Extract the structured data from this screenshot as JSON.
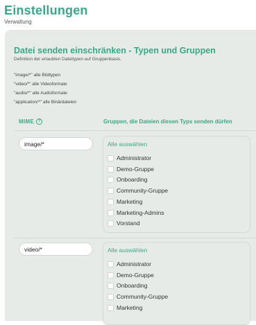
{
  "header": {
    "title": "Einstellungen",
    "subtitle": "Verwaltung"
  },
  "section": {
    "title": "Datei senden einschränken - Typen und Gruppen",
    "subtitle": "Definition der erlaubten Dateitypen auf Gruppenbasis.",
    "hints": [
      "\"image/*\" alle Bildtypen",
      "\"video/*\" alle Videoformate",
      "\"audio/*\" alle Audioformate",
      "\"application/*\" alle Binärdateien"
    ]
  },
  "table": {
    "col_mime": "MIME",
    "col_groups": "Gruppen, die Dateien diesen Typs senden dürfen",
    "rows": [
      {
        "mime": "image/*",
        "select_all": "Alle auswählen",
        "groups": [
          "Administrator",
          "Demo-Gruppe",
          "Onboarding",
          "Community-Gruppe",
          "Marketing",
          "Marketing-Admins",
          "Vorstand"
        ]
      },
      {
        "mime": "video/*",
        "select_all": "Alle auswählen",
        "groups": [
          "Administrator",
          "Demo-Gruppe",
          "Onboarding",
          "Community-Gruppe",
          "Marketing"
        ]
      }
    ]
  },
  "colors": {
    "accent": "#3aa887",
    "card_bg": "#e7ebe8"
  }
}
